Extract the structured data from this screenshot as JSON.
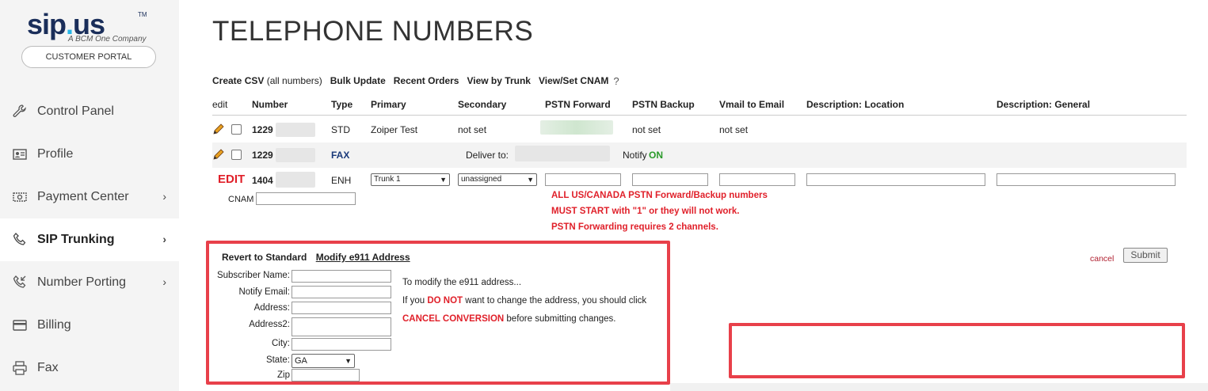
{
  "brand": {
    "logo_main": "sip",
    "logo_dot": ".",
    "logo_end": "us",
    "logo_tm": "TM",
    "logo_sub": "A BCM One Company",
    "portal_button": "CUSTOMER PORTAL"
  },
  "sidebar": {
    "items": [
      {
        "label": "Control Panel",
        "icon": "wrench-icon",
        "chevron": false
      },
      {
        "label": "Profile",
        "icon": "id-card-icon",
        "chevron": false
      },
      {
        "label": "Payment Center",
        "icon": "money-icon",
        "chevron": true
      },
      {
        "label": "SIP Trunking",
        "icon": "phone-icon",
        "chevron": true,
        "active": true
      },
      {
        "label": "Number Porting",
        "icon": "phone-incoming-icon",
        "chevron": true
      },
      {
        "label": "Billing",
        "icon": "credit-card-icon",
        "chevron": false
      },
      {
        "label": "Fax",
        "icon": "printer-icon",
        "chevron": false
      }
    ],
    "chevron_glyph": "›"
  },
  "page": {
    "title": "TELEPHONE NUMBERS"
  },
  "toolbar": {
    "create_csv": "Create CSV",
    "create_csv_sub": "(all numbers)",
    "bulk_update": "Bulk Update",
    "recent_orders": "Recent Orders",
    "view_by_trunk": "View by Trunk",
    "view_set_cnam": "View/Set CNAM",
    "help": "?"
  },
  "table": {
    "headers": {
      "edit": "edit",
      "number": "Number",
      "type": "Type",
      "primary": "Primary",
      "secondary": "Secondary",
      "pstn_forward": "PSTN Forward",
      "pstn_backup": "PSTN Backup",
      "vmail": "Vmail to Email",
      "desc_location": "Description: Location",
      "desc_general": "Description: General"
    },
    "row1": {
      "number": "1229",
      "type": "STD",
      "primary": "Zoiper Test",
      "secondary": "not set",
      "pstn_backup": "not set",
      "vmail": "not set"
    },
    "row2": {
      "number": "1229",
      "type": "FAX",
      "deliver_to": "Deliver to:",
      "notify": "Notify",
      "notify_state": "ON"
    },
    "row3": {
      "edit_label": "EDIT",
      "number": "1404",
      "type": "ENH",
      "primary_select": "Trunk 1",
      "secondary_select": "unassigned",
      "cnam_label": "CNAM",
      "warning_1": "ALL US/CANADA PSTN Forward/Backup numbers",
      "warning_2": "MUST START with \"1\" or they will not work.",
      "warning_3": "PSTN Forwarding requires 2 channels."
    }
  },
  "e911": {
    "revert": "Revert to Standard",
    "modify": "Modify e911 Address",
    "labels": {
      "subscriber": "Subscriber Name:",
      "email": "Notify Email:",
      "address": "Address:",
      "address2": "Address2:",
      "city": "City:",
      "state": "State:",
      "zip": "Zip"
    },
    "state_value": "GA",
    "info_1": "To modify the e911 address...",
    "info_2a": "If you ",
    "info_2b": "DO NOT",
    "info_2c": " want to change the address, you should click",
    "info_3a": "CANCEL CONVERSION",
    "info_3b": " before submitting changes."
  },
  "actions": {
    "cancel": "cancel",
    "submit": "Submit"
  },
  "colors": {
    "brand_navy": "#1a2e5a",
    "brand_cyan": "#26b5e8",
    "alert_red": "#e0202a",
    "highlight_box": "#e8404a",
    "notify_green": "#2a9a2a"
  }
}
